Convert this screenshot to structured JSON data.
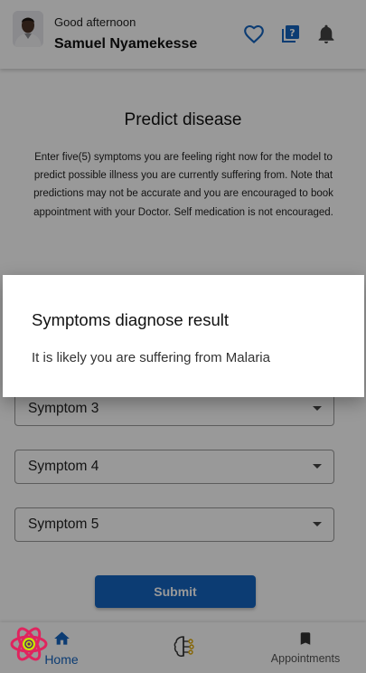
{
  "header": {
    "greeting": "Good afternoon",
    "username": "Samuel Nyamekesse",
    "icons": [
      "heart-icon",
      "help-icon",
      "bell-icon"
    ],
    "accent_color": "#1565c0"
  },
  "main": {
    "title": "Predict disease",
    "description": "Enter five(5) symptoms you are feeling right now for the model to predict possible illness you are currently suffering from. Note that predictions may not be accurate and you are encouraged to book appointment with your Doctor. Self medication is not encouraged.",
    "symptoms": [
      {
        "label": "Symptom 3"
      },
      {
        "label": "Symptom 4"
      },
      {
        "label": "Symptom 5"
      }
    ],
    "submit_label": "Submit",
    "submit_color": "#1565c0"
  },
  "bottom_nav": {
    "items": [
      {
        "label": "Home",
        "icon": "home-icon",
        "active": true
      },
      {
        "label": "",
        "icon": "ai-brain-icon",
        "active": false
      },
      {
        "label": "Appointments",
        "icon": "bookmark-icon",
        "active": false
      }
    ]
  },
  "dialog": {
    "title": "Symptoms diagnose result",
    "message": "It is likely you are suffering from Malaria"
  }
}
